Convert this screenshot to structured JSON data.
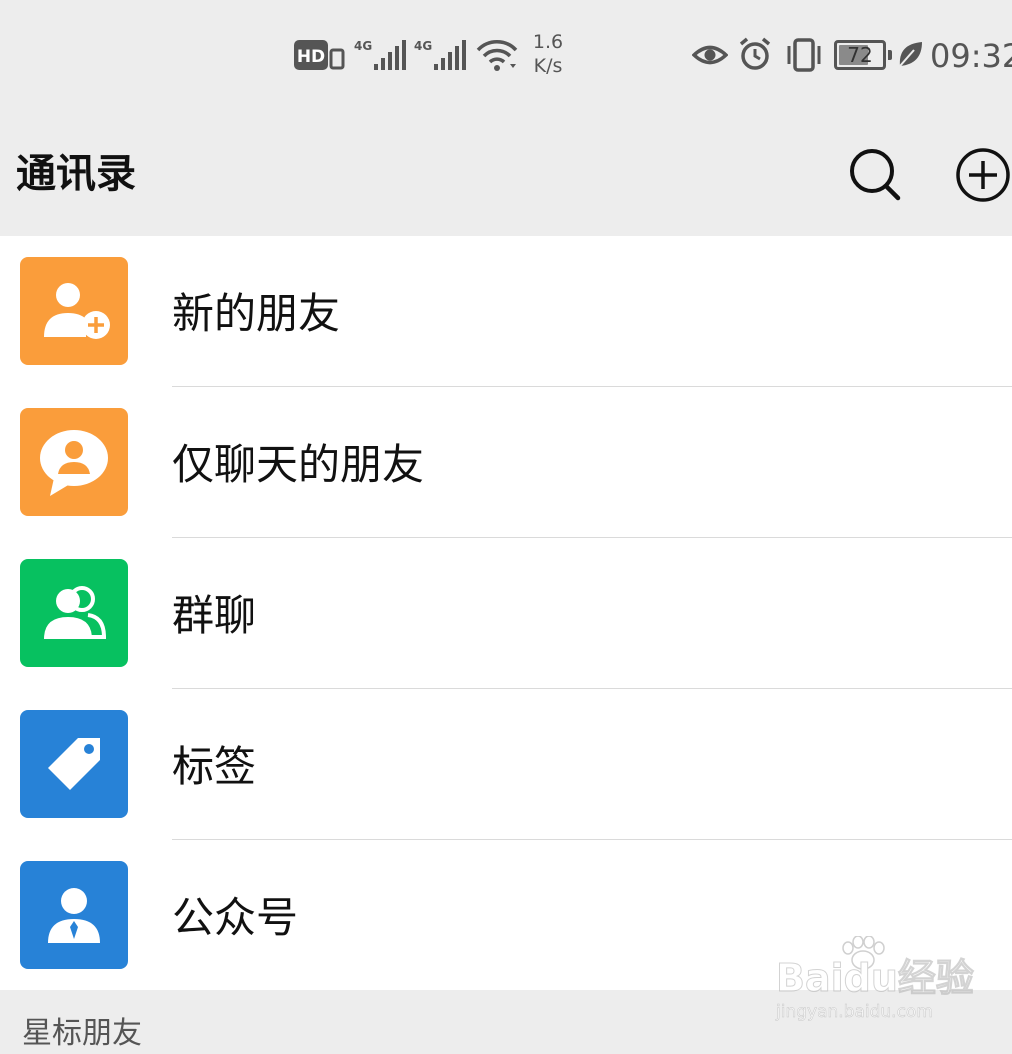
{
  "status_bar": {
    "hd_badge": "HD",
    "sim1_network": "4G",
    "sim2_network": "4G",
    "speed_value": "1.6",
    "speed_unit": "K/s",
    "battery_level": "72",
    "battery_fraction": 0.72,
    "time": "09:32"
  },
  "header": {
    "title": "通讯录"
  },
  "menu": {
    "items": [
      {
        "label": "新的朋友",
        "icon": "new-friend-icon",
        "color": "#fa9d3b"
      },
      {
        "label": "仅聊天的朋友",
        "icon": "chat-only-friend-icon",
        "color": "#fa9d3b"
      },
      {
        "label": "群聊",
        "icon": "group-chat-icon",
        "color": "#07c160"
      },
      {
        "label": "标签",
        "icon": "tag-icon",
        "color": "#2782d7"
      },
      {
        "label": "公众号",
        "icon": "official-account-icon",
        "color": "#2782d7"
      }
    ]
  },
  "section": {
    "starred_title": "星标朋友"
  },
  "watermark": {
    "brand": "Baidu经验",
    "url": "jingyan.baidu.com"
  }
}
